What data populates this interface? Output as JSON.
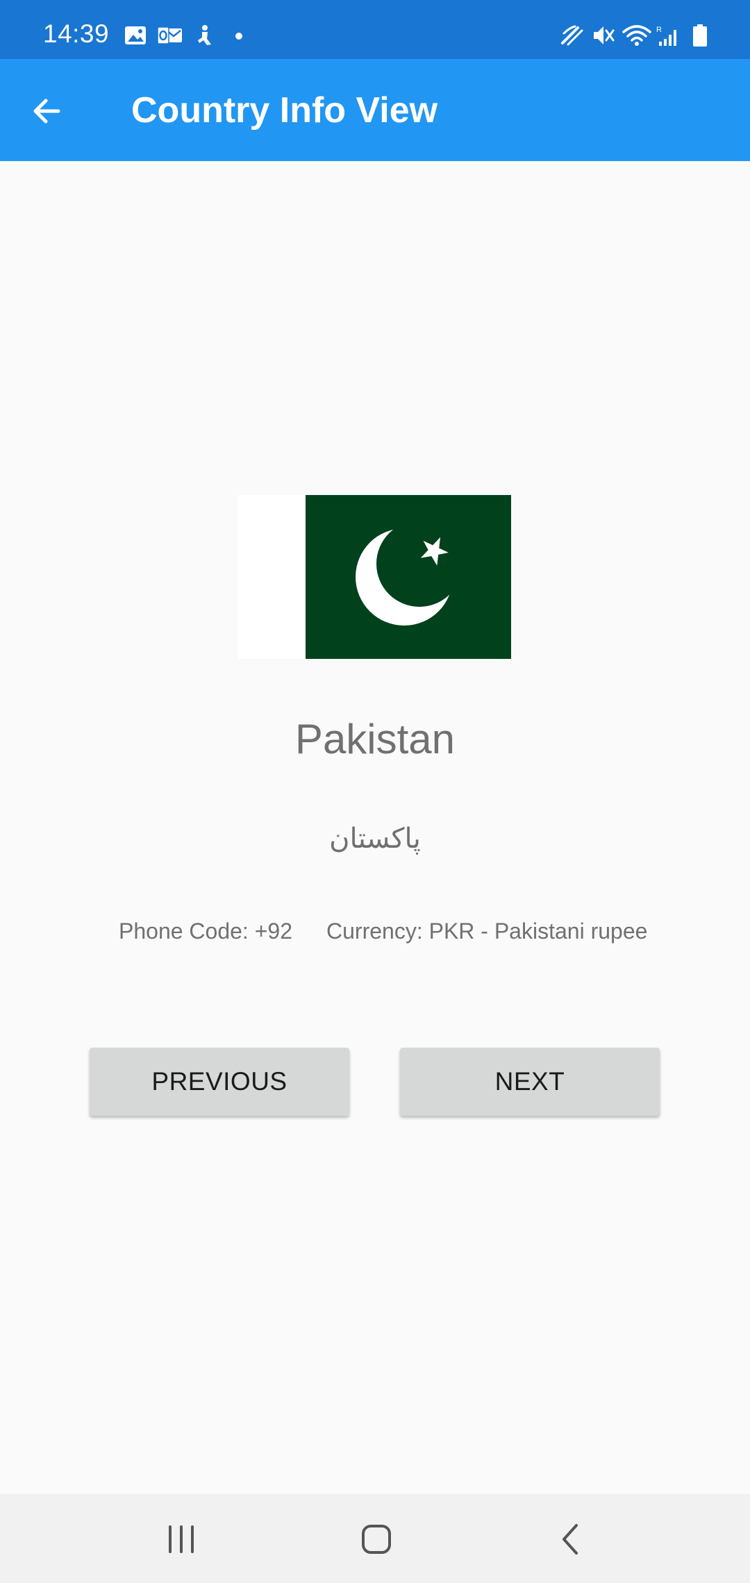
{
  "status_bar": {
    "time": "14:39",
    "left_icons": [
      "gallery-icon",
      "outlook-icon",
      "accessibility-icon",
      "dot-icon"
    ],
    "right_icons": [
      "nfc-icon",
      "mute-icon",
      "wifi-icon",
      "signal-icon",
      "battery-icon"
    ]
  },
  "app_bar": {
    "title": "Country Info View",
    "back_icon": "arrow-left-icon"
  },
  "country": {
    "flag": "pakistan-flag",
    "name": "Pakistan",
    "native_name": "پاکستان",
    "phone_code": "Phone Code: +92",
    "currency": "Currency: PKR - Pakistani rupee"
  },
  "buttons": {
    "previous": "PREVIOUS",
    "next": "NEXT"
  },
  "nav_bar": {
    "icons": [
      "recent-apps-icon",
      "home-icon",
      "back-icon"
    ]
  },
  "colors": {
    "status_bar": "#1976d2",
    "app_bar": "#2196f3",
    "flag_green": "#01411c",
    "button": "#d6d7d7"
  }
}
